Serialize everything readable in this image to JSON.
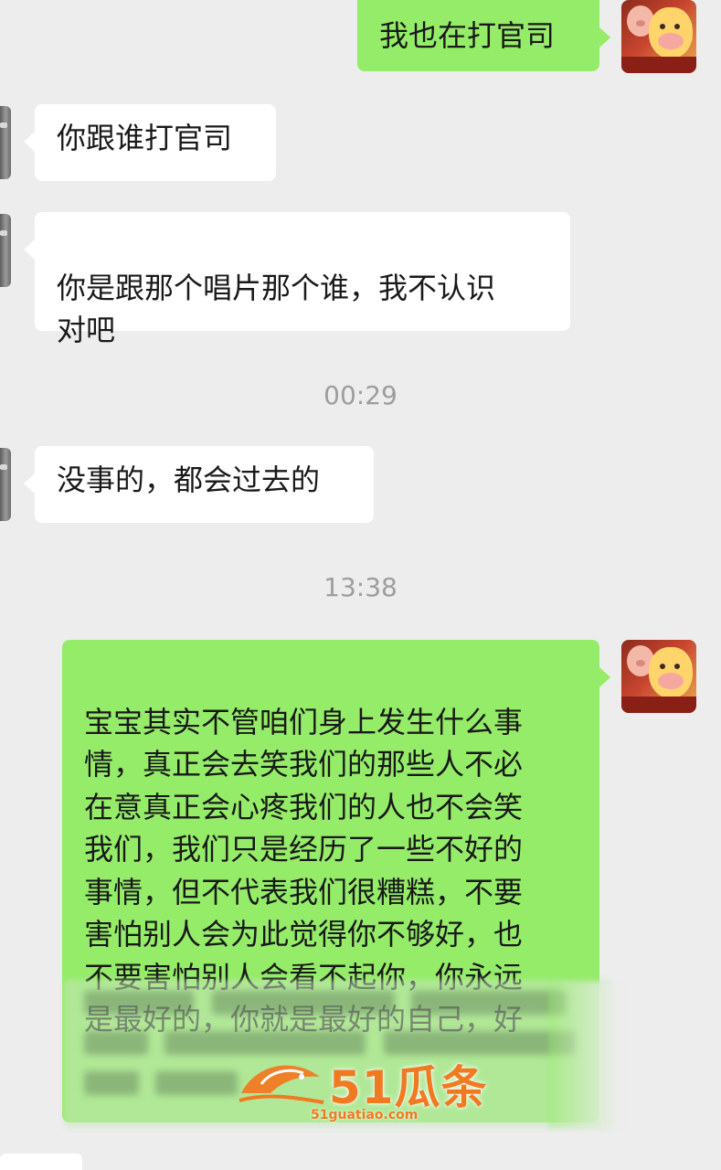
{
  "messages": [
    {
      "side": "out",
      "text": "我也在打官司"
    },
    {
      "side": "in",
      "text": "你跟谁打官司"
    },
    {
      "side": "in",
      "text": "你是跟那个唱片那个谁，我不认识\n对吧"
    },
    {
      "side": "in",
      "text": "没事的，都会过去的"
    },
    {
      "side": "out",
      "text": "宝宝其实不管咱们身上发生什么事\n情，真正会去笑我们的那些人不必\n在意真正会心疼我们的人也不会笑\n我们，我们只是经历了一些不好的\n事情，但不代表我们很糟糕，不要\n害怕别人会为此觉得你不够好，也\n不要害怕别人会看不起你，你永远\n是最好的，你就是最好的自己，好"
    }
  ],
  "timestamps": [
    "00:29",
    "13:38"
  ],
  "watermark": {
    "brand": "51瓜条",
    "url": "51guatiao.com",
    "color": "#f07a22"
  },
  "colors": {
    "background": "#ededed",
    "bubble_out": "#95ec69",
    "bubble_in": "#ffffff",
    "timestamp": "#9d9d9d"
  }
}
